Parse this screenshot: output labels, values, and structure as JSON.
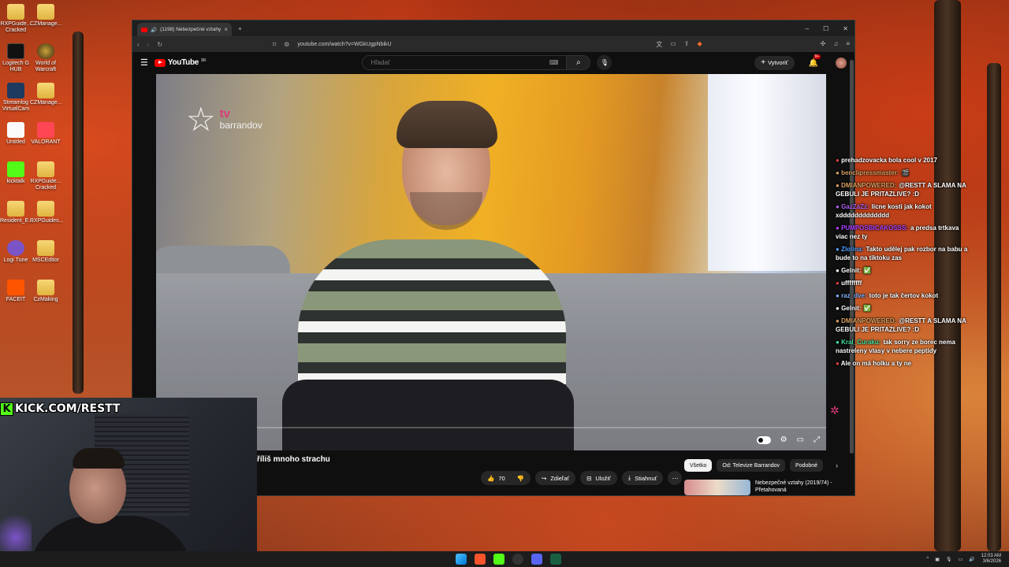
{
  "browser": {
    "tab_title": "(1198) Nebezpečné vztahy (2",
    "tab_close": "×",
    "new_tab": "+",
    "url": "youtube.com/watch?v=WGkUgpNbikU",
    "window_controls": [
      "–",
      "☐",
      "✕"
    ]
  },
  "youtube": {
    "logo": "YouTube",
    "region": "SK",
    "search_placeholder": "Hľadať",
    "create_label": "Vytvoriť",
    "notification_count": "9+",
    "video_title": "říliš mnoho strachu",
    "like_count": "70",
    "share_label": "Zdieľať",
    "save_label": "Uložiť",
    "download_label": "Stiahnuť",
    "chips": [
      "Všetko",
      "Od: Televize Barrandov",
      "Podobné"
    ],
    "recommendation": {
      "title": "Nebezpečné vztahy (2019/74) - Přetahovaná"
    }
  },
  "video_overlay": {
    "logo_top": "tv",
    "logo_bottom": "barrandov"
  },
  "chat": [
    {
      "user": "",
      "text": "prehadzovacka bola cool v 2017",
      "color": "#e04040"
    },
    {
      "user": "benclipressmaster:",
      "text": "🎬",
      "color": "#d8a060"
    },
    {
      "user": "DMIANPOWERED:",
      "text": "@RESTT A SLAMA NA GEBULI JE PRITAZLIVE? :D",
      "color": "#d8a060"
    },
    {
      "user": "GazZaZz:",
      "text": "lícne kosti jak kokot xddddddddddddd",
      "color": "#b060f0"
    },
    {
      "user": "PUMPOSBICAKOSSS:",
      "text": "a predsa trtkava viac nez ty",
      "color": "#b040ff"
    },
    {
      "user": "Zlolina:",
      "text": "Takto udělej pak rozbor na babu a bude to na tiktoku zas",
      "color": "#4fa0ff"
    },
    {
      "user": "Gelnit:",
      "text": "✅",
      "color": "#ffffff"
    },
    {
      "user": "",
      "text": "uffffffff",
      "color": "#e04040"
    },
    {
      "user": "raz_dve:",
      "text": "toto je tak čertov kokot",
      "color": "#7fb0ff"
    },
    {
      "user": "Gelnit:",
      "text": "✅",
      "color": "#ffffff"
    },
    {
      "user": "DMIANPOWERED:",
      "text": "@RESTT A SLAMA NA GEBULI JE PRITAZLIVE? :D",
      "color": "#d8a060"
    },
    {
      "user": "Kral_Curaku:",
      "text": "tak sorry ze borec nema nastreleny vlasy v nebere peptidy",
      "color": "#40e0a0"
    },
    {
      "user": "",
      "text": "Ale on má holku a ty ne",
      "color": "#e04040"
    }
  ],
  "stream": {
    "kick_label": "KICK.COM/RESTT"
  },
  "desktop_icons": [
    {
      "label": "RXPGuide... Cracked",
      "type": "folder"
    },
    {
      "label": "CZManage...",
      "type": "folder"
    },
    {
      "label": "Logitech G HUB",
      "type": "logitech"
    },
    {
      "label": "World of Warcraft",
      "type": "wow"
    },
    {
      "label": "Streamlog VirtualCam",
      "type": "cam"
    },
    {
      "label": "CZManage...",
      "type": "folder"
    },
    {
      "label": "Untitled",
      "type": "file"
    },
    {
      "label": "VALORANT",
      "type": "valorant"
    },
    {
      "label": "kicktalk",
      "type": "kick"
    },
    {
      "label": "RXPGuide... Cracked",
      "type": "folder"
    },
    {
      "label": "Resident_E...",
      "type": "folder"
    },
    {
      "label": "RXPGuides...",
      "type": "folder"
    },
    {
      "label": "Logi Tune",
      "type": "logitune"
    },
    {
      "label": "MSCEditor",
      "type": "folder"
    },
    {
      "label": "FACEIT",
      "type": "faceit"
    },
    {
      "label": "CzMaking",
      "type": "folder"
    }
  ],
  "taskbar": {
    "time": "12:03 AM",
    "date": "3/6/2026"
  },
  "colors": {
    "youtube_red": "#ff0000",
    "kick_green": "#53fc18",
    "barrandov_pink": "#e0397a"
  }
}
